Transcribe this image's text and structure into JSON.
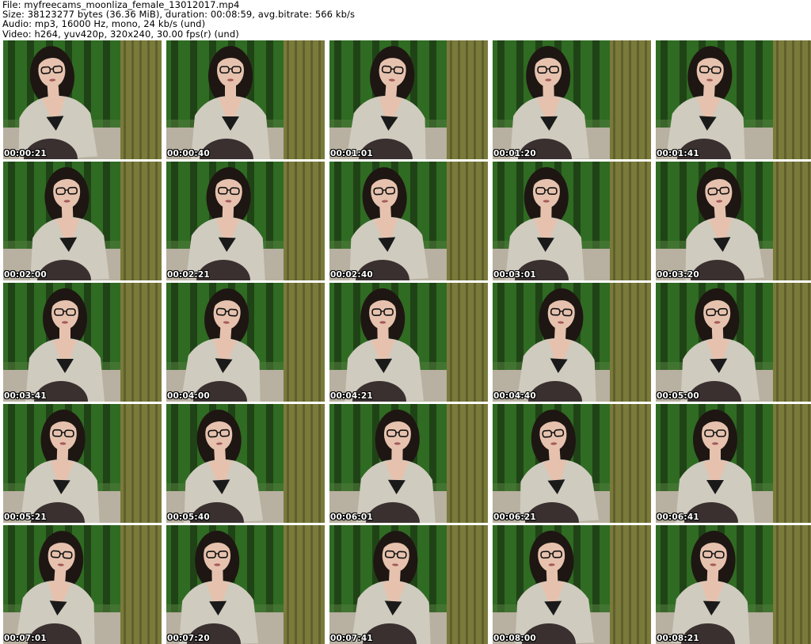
{
  "header": {
    "file": "File: myfreecams_moonliza_female_13012017.mp4",
    "size": "Size: 38123277 bytes (36.36 MiB), duration: 00:08:59, avg.bitrate: 566 kb/s",
    "audio": "Audio: mp3, 16000 Hz, mono, 24 kb/s (und)",
    "video": "Video: h264, yuv420p, 320x240, 30.00 fps(r) (und)"
  },
  "colors": {
    "wall_green": "#2f6b22",
    "wall_stripe": "#1c3a14",
    "curtain": "#7a7a3a",
    "cardigan": "#cfcbbf",
    "hair": "#1e1612",
    "skin": "#e6c2ae",
    "stocking": "#3a3030"
  },
  "thumbnails": [
    {
      "time": "00:00:21"
    },
    {
      "time": "00:00:40"
    },
    {
      "time": "00:01:01"
    },
    {
      "time": "00:01:20"
    },
    {
      "time": "00:01:41"
    },
    {
      "time": "00:02:00"
    },
    {
      "time": "00:02:21"
    },
    {
      "time": "00:02:40"
    },
    {
      "time": "00:03:01"
    },
    {
      "time": "00:03:20"
    },
    {
      "time": "00:03:41"
    },
    {
      "time": "00:04:00"
    },
    {
      "time": "00:04:21"
    },
    {
      "time": "00:04:40"
    },
    {
      "time": "00:05:00"
    },
    {
      "time": "00:05:21"
    },
    {
      "time": "00:05:40"
    },
    {
      "time": "00:06:01"
    },
    {
      "time": "00:06:21"
    },
    {
      "time": "00:06:41"
    },
    {
      "time": "00:07:01"
    },
    {
      "time": "00:07:20"
    },
    {
      "time": "00:07:41"
    },
    {
      "time": "00:08:00"
    },
    {
      "time": "00:08:21"
    }
  ]
}
